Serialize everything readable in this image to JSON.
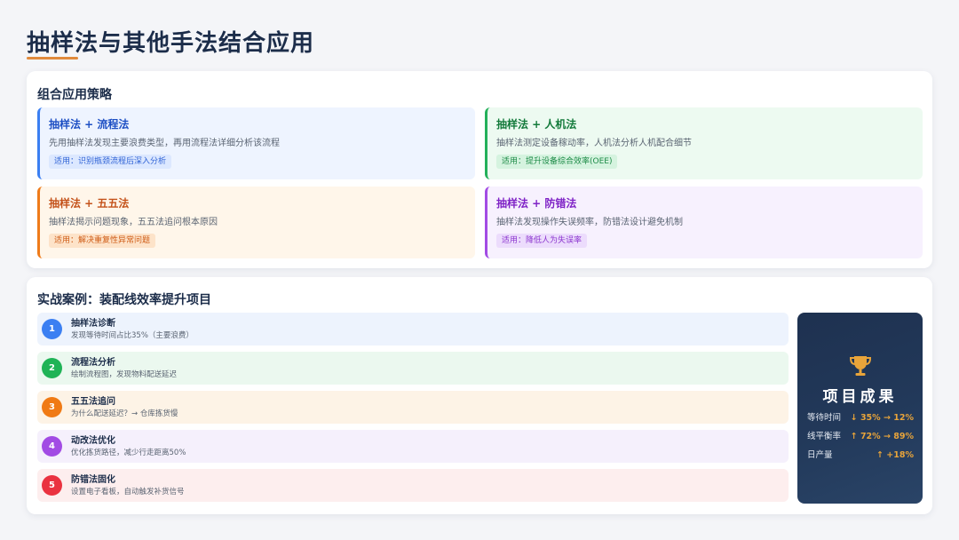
{
  "page_title": "抽样法与其他手法结合应用",
  "strategies_section": {
    "heading": "组合应用策略",
    "cards": [
      {
        "title": "抽样法 + 流程法",
        "description": "先用抽样法发现主要浪费类型，再用流程法详细分析该流程",
        "tag": "适用：识别瓶颈流程后深入分析",
        "accent": "#3b7ff2"
      },
      {
        "title": "抽样法 + 人机法",
        "description": "抽样法测定设备稼动率，人机法分析人机配合细节",
        "tag": "适用：提升设备综合效率(OEE)",
        "accent": "#23b05a"
      },
      {
        "title": "抽样法 + 五五法",
        "description": "抽样法揭示问题现象，五五法追问根本原因",
        "tag": "适用：解决重复性异常问题",
        "accent": "#ef7b1a"
      },
      {
        "title": "抽样法 + 防错法",
        "description": "抽样法发现操作失误频率，防错法设计避免机制",
        "tag": "适用：降低人为失误率",
        "accent": "#a24be4"
      }
    ]
  },
  "case_section": {
    "heading": "实战案例：装配线效率提升项目",
    "steps": [
      {
        "number": "1",
        "title": "抽样法诊断",
        "description": "发现等待时间占比35%（主要浪费）",
        "color": "#3b7ff2"
      },
      {
        "number": "2",
        "title": "流程法分析",
        "description": "绘制流程图，发现物料配送延迟",
        "color": "#1fb356"
      },
      {
        "number": "3",
        "title": "五五法追问",
        "description": "为什么配送延迟？→ 仓库拣货慢",
        "color": "#f07a14"
      },
      {
        "number": "4",
        "title": "动改法优化",
        "description": "优化拣货路径，减少行走距离50%",
        "color": "#a24be4"
      },
      {
        "number": "5",
        "title": "防错法固化",
        "description": "设置电子看板，自动触发补货信号",
        "color": "#ea3240"
      }
    ],
    "results": {
      "icon": "trophy-icon",
      "title": "项目成果",
      "metrics": [
        {
          "label": "等待时间",
          "value": "↓ 35% → 12%"
        },
        {
          "label": "线平衡率",
          "value": "↑ 72% → 89%"
        },
        {
          "label": "日产量",
          "value": "↑ +18%"
        }
      ]
    }
  }
}
